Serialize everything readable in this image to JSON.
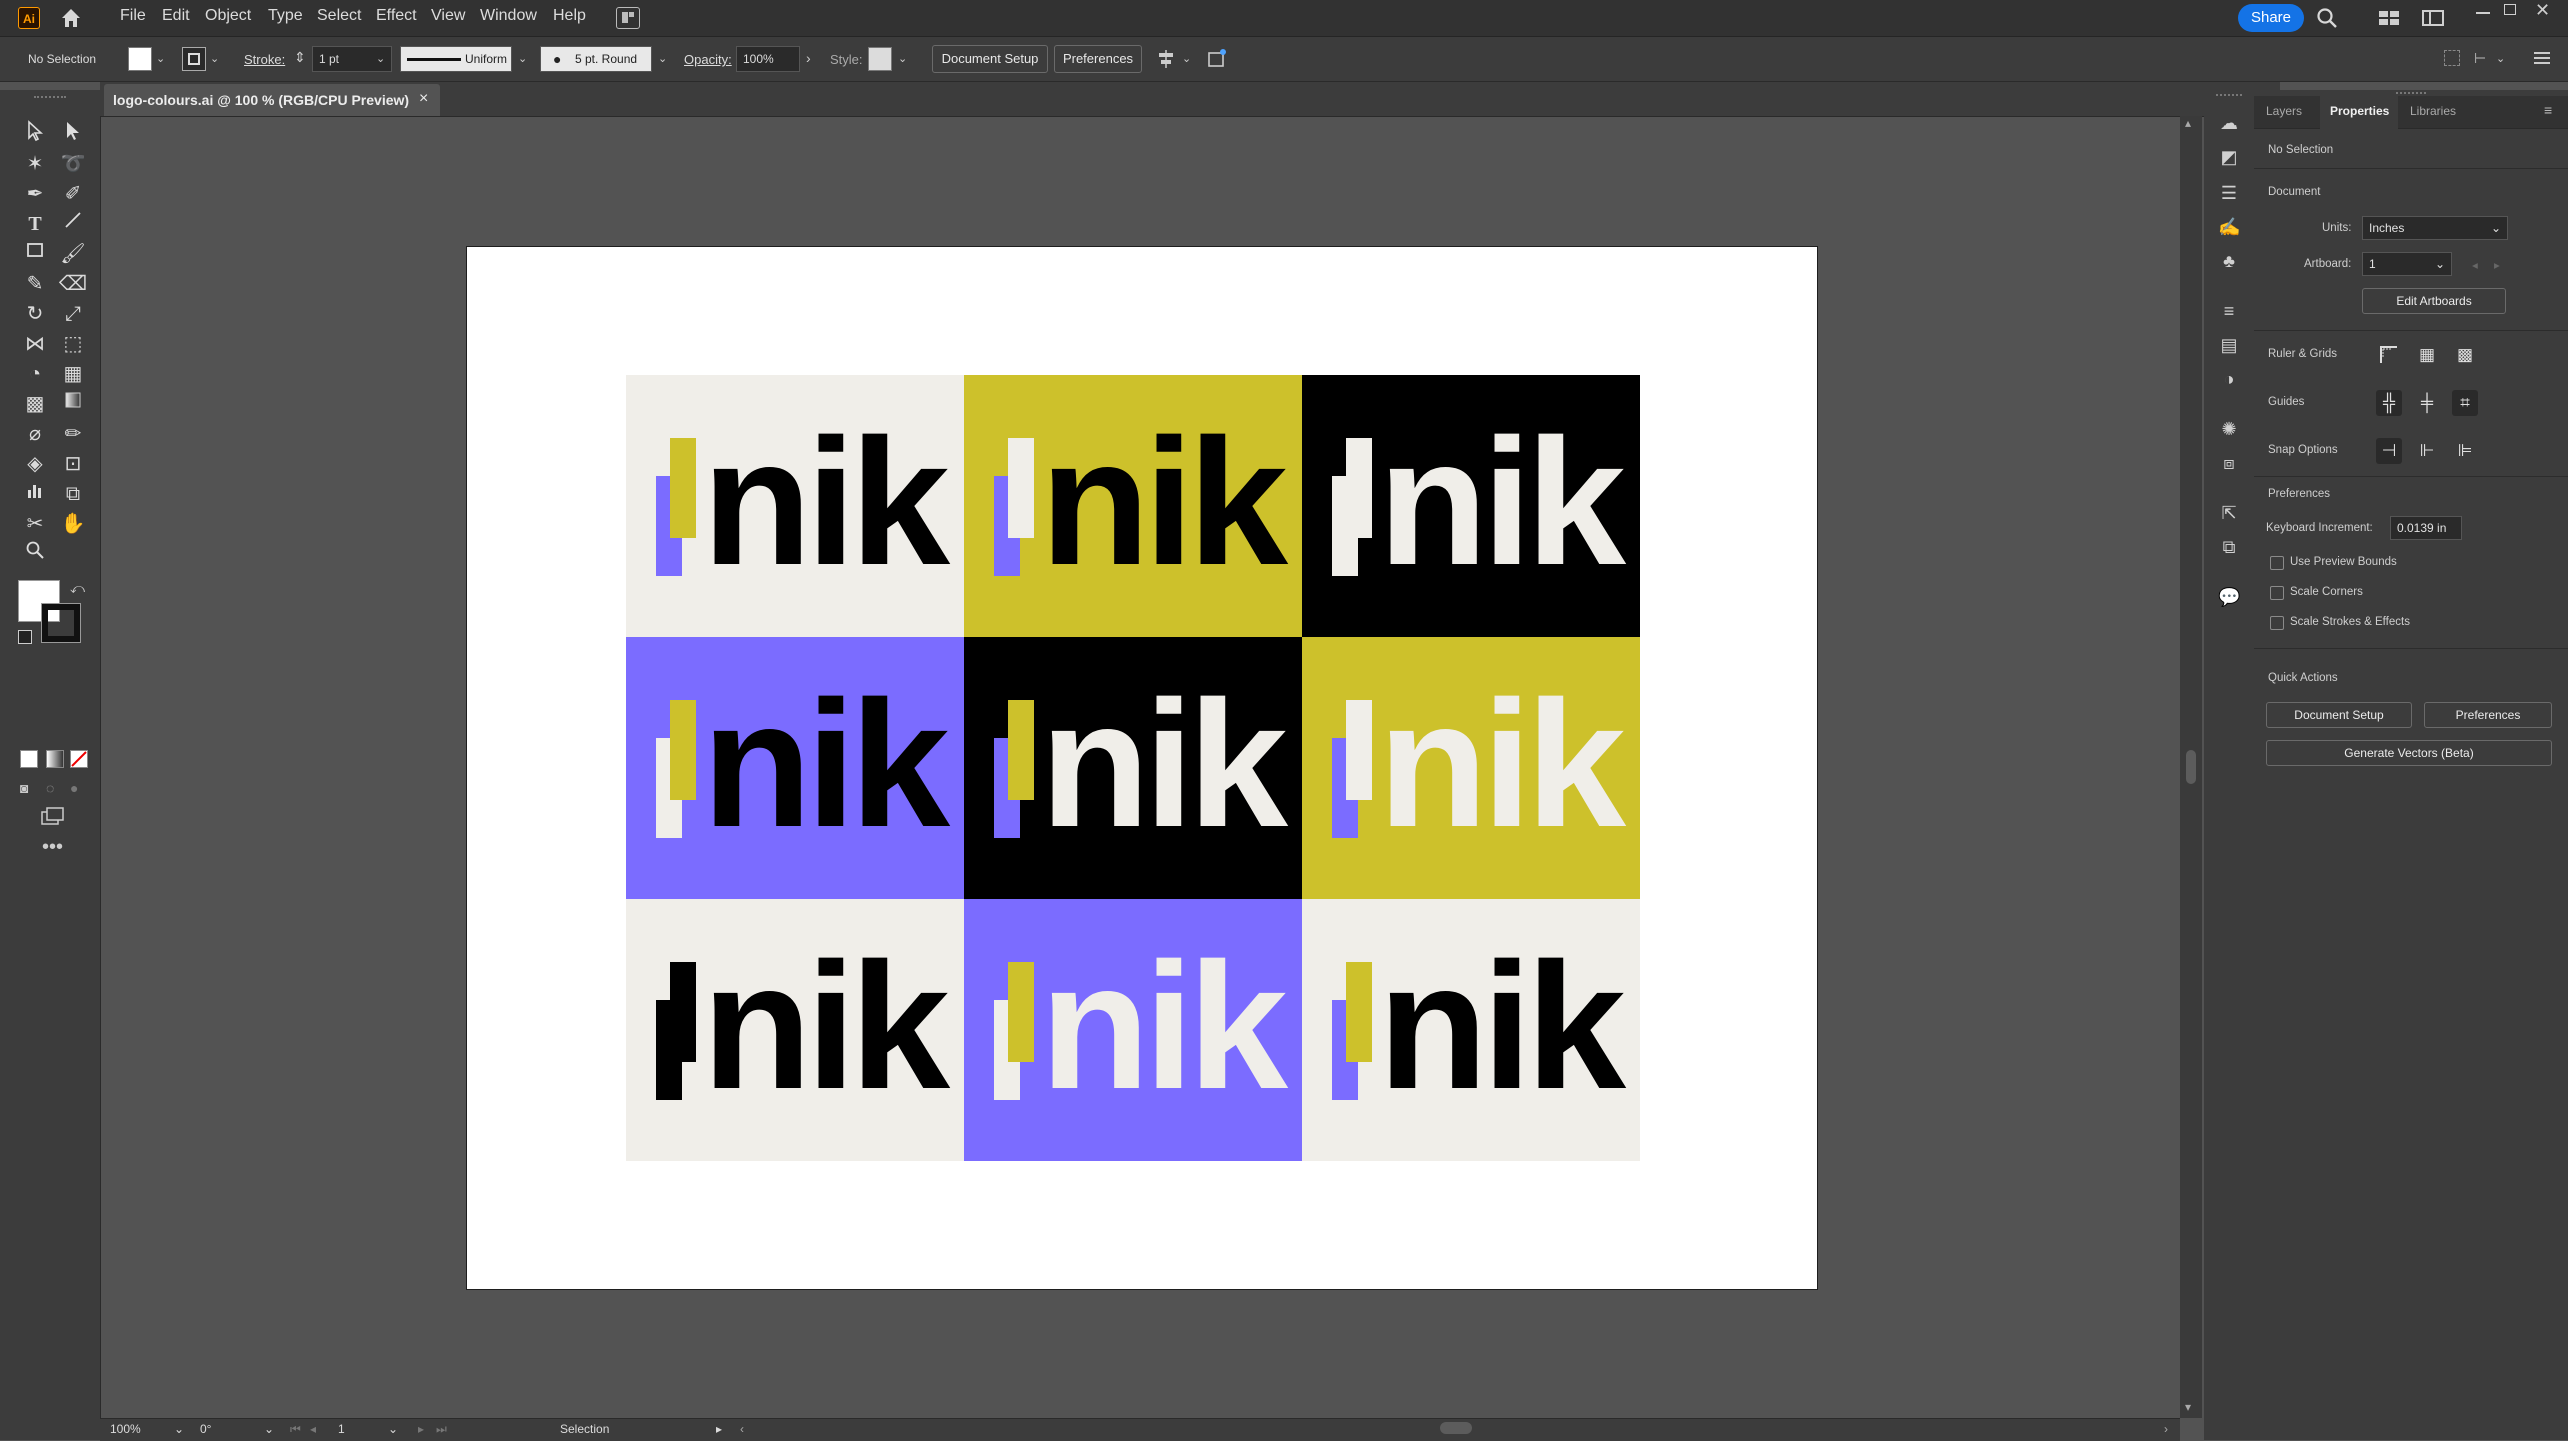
{
  "app": {
    "logo_text": "Ai"
  },
  "menu": [
    "File",
    "Edit",
    "Object",
    "Type",
    "Select",
    "Effect",
    "View",
    "Window",
    "Help"
  ],
  "share_label": "Share",
  "control_bar": {
    "selection_state": "No Selection",
    "stroke_label": "Stroke:",
    "stroke_weight": "1 pt",
    "stroke_profile": "Uniform",
    "brush": "5 pt. Round",
    "opacity_label": "Opacity:",
    "opacity_value": "100%",
    "style_label": "Style:",
    "document_setup": "Document Setup",
    "preferences": "Preferences"
  },
  "document_tab": {
    "title": "logo-colours.ai @ 100 % (RGB/CPU Preview)",
    "close": "×"
  },
  "artboard": {
    "logo_text": "nik",
    "colors": {
      "cream": "#f0eee9",
      "olive": "#cdc12b",
      "black": "#000000",
      "purple": "#7b6cff"
    },
    "tiles": [
      {
        "bg": "#f0eee9",
        "text": "#000000",
        "tall": "#cdc12b",
        "short": "#7b6cff"
      },
      {
        "bg": "#cdc12b",
        "text": "#000000",
        "tall": "#f0eee9",
        "short": "#7b6cff"
      },
      {
        "bg": "#000000",
        "text": "#f0eee9",
        "tall": "#f0eee9",
        "short": "#f0eee9"
      },
      {
        "bg": "#7b6cff",
        "text": "#000000",
        "tall": "#cdc12b",
        "short": "#f0eee9"
      },
      {
        "bg": "#000000",
        "text": "#f0eee9",
        "tall": "#cdc12b",
        "short": "#7b6cff"
      },
      {
        "bg": "#cdc12b",
        "text": "#f0eee9",
        "tall": "#f0eee9",
        "short": "#7b6cff"
      },
      {
        "bg": "#f0eee9",
        "text": "#000000",
        "tall": "#000000",
        "short": "#000000"
      },
      {
        "bg": "#7b6cff",
        "text": "#f0eee9",
        "tall": "#cdc12b",
        "short": "#f0eee9"
      },
      {
        "bg": "#f0eee9",
        "text": "#000000",
        "tall": "#cdc12b",
        "short": "#7b6cff"
      }
    ]
  },
  "status_bar": {
    "zoom": "100%",
    "rotation": "0°",
    "artboard_number": "1",
    "tool": "Selection"
  },
  "properties": {
    "tabs": [
      "Layers",
      "Properties",
      "Libraries"
    ],
    "selection": "No Selection",
    "document_heading": "Document",
    "units_label": "Units:",
    "units_value": "Inches",
    "artboard_label": "Artboard:",
    "artboard_value": "1",
    "edit_artboards": "Edit Artboards",
    "ruler_grids": "Ruler & Grids",
    "guides": "Guides",
    "snap_options": "Snap Options",
    "preferences_heading": "Preferences",
    "keyboard_increment_label": "Keyboard Increment:",
    "keyboard_increment_value": "0.0139 in",
    "use_preview_bounds": "Use Preview Bounds",
    "scale_corners": "Scale Corners",
    "scale_strokes": "Scale Strokes & Effects",
    "quick_actions": "Quick Actions",
    "qa_document_setup": "Document Setup",
    "qa_preferences": "Preferences",
    "generate_vectors": "Generate Vectors (Beta)"
  }
}
